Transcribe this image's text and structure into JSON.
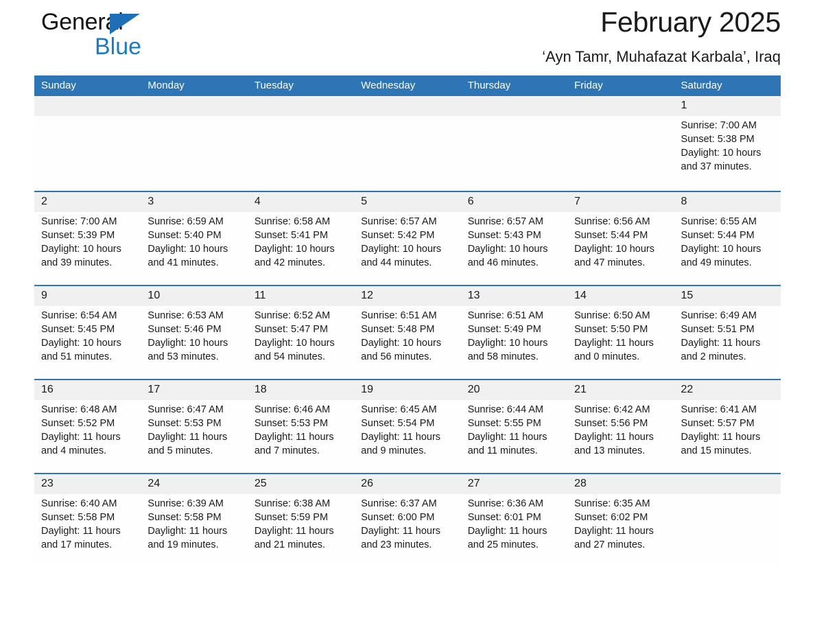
{
  "brand": {
    "word1": "General",
    "word2": "Blue",
    "triangle_color": "#1F6FB8",
    "blue_color": "#1B7BC4"
  },
  "header": {
    "title": "February 2025",
    "subtitle": "‘Ayn Tamr, Muhafazat Karbala’, Iraq"
  },
  "theme": {
    "header_blue": "#2E75B6",
    "daynum_gray": "#F0F0F0",
    "text": "#1a1a1a"
  },
  "labels": {
    "sunrise_prefix": "Sunrise: ",
    "sunset_prefix": "Sunset: ",
    "daylight_prefix": "Daylight: "
  },
  "weekdays": [
    "Sunday",
    "Monday",
    "Tuesday",
    "Wednesday",
    "Thursday",
    "Friday",
    "Saturday"
  ],
  "weeks": [
    [
      {
        "day": "",
        "sunrise": "",
        "sunset": "",
        "daylight": ""
      },
      {
        "day": "",
        "sunrise": "",
        "sunset": "",
        "daylight": ""
      },
      {
        "day": "",
        "sunrise": "",
        "sunset": "",
        "daylight": ""
      },
      {
        "day": "",
        "sunrise": "",
        "sunset": "",
        "daylight": ""
      },
      {
        "day": "",
        "sunrise": "",
        "sunset": "",
        "daylight": ""
      },
      {
        "day": "",
        "sunrise": "",
        "sunset": "",
        "daylight": ""
      },
      {
        "day": "1",
        "sunrise": "Sunrise: 7:00 AM",
        "sunset": "Sunset: 5:38 PM",
        "daylight": "Daylight: 10 hours and 37 minutes."
      }
    ],
    [
      {
        "day": "2",
        "sunrise": "Sunrise: 7:00 AM",
        "sunset": "Sunset: 5:39 PM",
        "daylight": "Daylight: 10 hours and 39 minutes."
      },
      {
        "day": "3",
        "sunrise": "Sunrise: 6:59 AM",
        "sunset": "Sunset: 5:40 PM",
        "daylight": "Daylight: 10 hours and 41 minutes."
      },
      {
        "day": "4",
        "sunrise": "Sunrise: 6:58 AM",
        "sunset": "Sunset: 5:41 PM",
        "daylight": "Daylight: 10 hours and 42 minutes."
      },
      {
        "day": "5",
        "sunrise": "Sunrise: 6:57 AM",
        "sunset": "Sunset: 5:42 PM",
        "daylight": "Daylight: 10 hours and 44 minutes."
      },
      {
        "day": "6",
        "sunrise": "Sunrise: 6:57 AM",
        "sunset": "Sunset: 5:43 PM",
        "daylight": "Daylight: 10 hours and 46 minutes."
      },
      {
        "day": "7",
        "sunrise": "Sunrise: 6:56 AM",
        "sunset": "Sunset: 5:44 PM",
        "daylight": "Daylight: 10 hours and 47 minutes."
      },
      {
        "day": "8",
        "sunrise": "Sunrise: 6:55 AM",
        "sunset": "Sunset: 5:44 PM",
        "daylight": "Daylight: 10 hours and 49 minutes."
      }
    ],
    [
      {
        "day": "9",
        "sunrise": "Sunrise: 6:54 AM",
        "sunset": "Sunset: 5:45 PM",
        "daylight": "Daylight: 10 hours and 51 minutes."
      },
      {
        "day": "10",
        "sunrise": "Sunrise: 6:53 AM",
        "sunset": "Sunset: 5:46 PM",
        "daylight": "Daylight: 10 hours and 53 minutes."
      },
      {
        "day": "11",
        "sunrise": "Sunrise: 6:52 AM",
        "sunset": "Sunset: 5:47 PM",
        "daylight": "Daylight: 10 hours and 54 minutes."
      },
      {
        "day": "12",
        "sunrise": "Sunrise: 6:51 AM",
        "sunset": "Sunset: 5:48 PM",
        "daylight": "Daylight: 10 hours and 56 minutes."
      },
      {
        "day": "13",
        "sunrise": "Sunrise: 6:51 AM",
        "sunset": "Sunset: 5:49 PM",
        "daylight": "Daylight: 10 hours and 58 minutes."
      },
      {
        "day": "14",
        "sunrise": "Sunrise: 6:50 AM",
        "sunset": "Sunset: 5:50 PM",
        "daylight": "Daylight: 11 hours and 0 minutes."
      },
      {
        "day": "15",
        "sunrise": "Sunrise: 6:49 AM",
        "sunset": "Sunset: 5:51 PM",
        "daylight": "Daylight: 11 hours and 2 minutes."
      }
    ],
    [
      {
        "day": "16",
        "sunrise": "Sunrise: 6:48 AM",
        "sunset": "Sunset: 5:52 PM",
        "daylight": "Daylight: 11 hours and 4 minutes."
      },
      {
        "day": "17",
        "sunrise": "Sunrise: 6:47 AM",
        "sunset": "Sunset: 5:53 PM",
        "daylight": "Daylight: 11 hours and 5 minutes."
      },
      {
        "day": "18",
        "sunrise": "Sunrise: 6:46 AM",
        "sunset": "Sunset: 5:53 PM",
        "daylight": "Daylight: 11 hours and 7 minutes."
      },
      {
        "day": "19",
        "sunrise": "Sunrise: 6:45 AM",
        "sunset": "Sunset: 5:54 PM",
        "daylight": "Daylight: 11 hours and 9 minutes."
      },
      {
        "day": "20",
        "sunrise": "Sunrise: 6:44 AM",
        "sunset": "Sunset: 5:55 PM",
        "daylight": "Daylight: 11 hours and 11 minutes."
      },
      {
        "day": "21",
        "sunrise": "Sunrise: 6:42 AM",
        "sunset": "Sunset: 5:56 PM",
        "daylight": "Daylight: 11 hours and 13 minutes."
      },
      {
        "day": "22",
        "sunrise": "Sunrise: 6:41 AM",
        "sunset": "Sunset: 5:57 PM",
        "daylight": "Daylight: 11 hours and 15 minutes."
      }
    ],
    [
      {
        "day": "23",
        "sunrise": "Sunrise: 6:40 AM",
        "sunset": "Sunset: 5:58 PM",
        "daylight": "Daylight: 11 hours and 17 minutes."
      },
      {
        "day": "24",
        "sunrise": "Sunrise: 6:39 AM",
        "sunset": "Sunset: 5:58 PM",
        "daylight": "Daylight: 11 hours and 19 minutes."
      },
      {
        "day": "25",
        "sunrise": "Sunrise: 6:38 AM",
        "sunset": "Sunset: 5:59 PM",
        "daylight": "Daylight: 11 hours and 21 minutes."
      },
      {
        "day": "26",
        "sunrise": "Sunrise: 6:37 AM",
        "sunset": "Sunset: 6:00 PM",
        "daylight": "Daylight: 11 hours and 23 minutes."
      },
      {
        "day": "27",
        "sunrise": "Sunrise: 6:36 AM",
        "sunset": "Sunset: 6:01 PM",
        "daylight": "Daylight: 11 hours and 25 minutes."
      },
      {
        "day": "28",
        "sunrise": "Sunrise: 6:35 AM",
        "sunset": "Sunset: 6:02 PM",
        "daylight": "Daylight: 11 hours and 27 minutes."
      },
      {
        "day": "",
        "sunrise": "",
        "sunset": "",
        "daylight": ""
      }
    ]
  ]
}
